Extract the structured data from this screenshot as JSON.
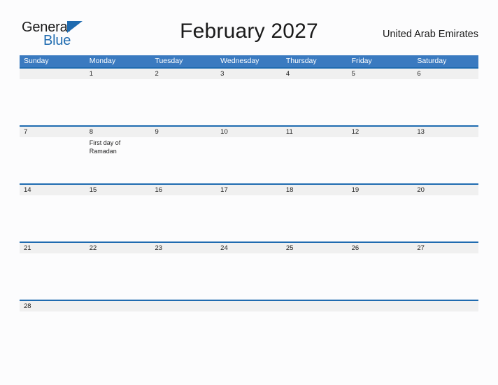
{
  "brand": {
    "name_part1": "General",
    "name_part2": "Blue",
    "triangle_icon": "triangle-icon",
    "color_dark": "#1a1a1a",
    "color_blue": "#1f6bb0"
  },
  "header": {
    "title": "February 2027",
    "region": "United Arab Emirates"
  },
  "theme": {
    "header_blue": "#3a7ac0",
    "rule_blue": "#1f6bb0",
    "number_band": "#f0f0f0",
    "page_background": "#fcfcfd"
  },
  "calendar": {
    "month": "February",
    "year": "2027",
    "weekdays": [
      "Sunday",
      "Monday",
      "Tuesday",
      "Wednesday",
      "Thursday",
      "Friday",
      "Saturday"
    ],
    "weeks": [
      {
        "days": [
          {
            "number": "",
            "event": ""
          },
          {
            "number": "1",
            "event": ""
          },
          {
            "number": "2",
            "event": ""
          },
          {
            "number": "3",
            "event": ""
          },
          {
            "number": "4",
            "event": ""
          },
          {
            "number": "5",
            "event": ""
          },
          {
            "number": "6",
            "event": ""
          }
        ]
      },
      {
        "days": [
          {
            "number": "7",
            "event": ""
          },
          {
            "number": "8",
            "event": "First day of Ramadan"
          },
          {
            "number": "9",
            "event": ""
          },
          {
            "number": "10",
            "event": ""
          },
          {
            "number": "11",
            "event": ""
          },
          {
            "number": "12",
            "event": ""
          },
          {
            "number": "13",
            "event": ""
          }
        ]
      },
      {
        "days": [
          {
            "number": "14",
            "event": ""
          },
          {
            "number": "15",
            "event": ""
          },
          {
            "number": "16",
            "event": ""
          },
          {
            "number": "17",
            "event": ""
          },
          {
            "number": "18",
            "event": ""
          },
          {
            "number": "19",
            "event": ""
          },
          {
            "number": "20",
            "event": ""
          }
        ]
      },
      {
        "days": [
          {
            "number": "21",
            "event": ""
          },
          {
            "number": "22",
            "event": ""
          },
          {
            "number": "23",
            "event": ""
          },
          {
            "number": "24",
            "event": ""
          },
          {
            "number": "25",
            "event": ""
          },
          {
            "number": "26",
            "event": ""
          },
          {
            "number": "27",
            "event": ""
          }
        ]
      },
      {
        "days": [
          {
            "number": "28",
            "event": ""
          },
          {
            "number": "",
            "event": ""
          },
          {
            "number": "",
            "event": ""
          },
          {
            "number": "",
            "event": ""
          },
          {
            "number": "",
            "event": ""
          },
          {
            "number": "",
            "event": ""
          },
          {
            "number": "",
            "event": ""
          }
        ]
      }
    ]
  }
}
